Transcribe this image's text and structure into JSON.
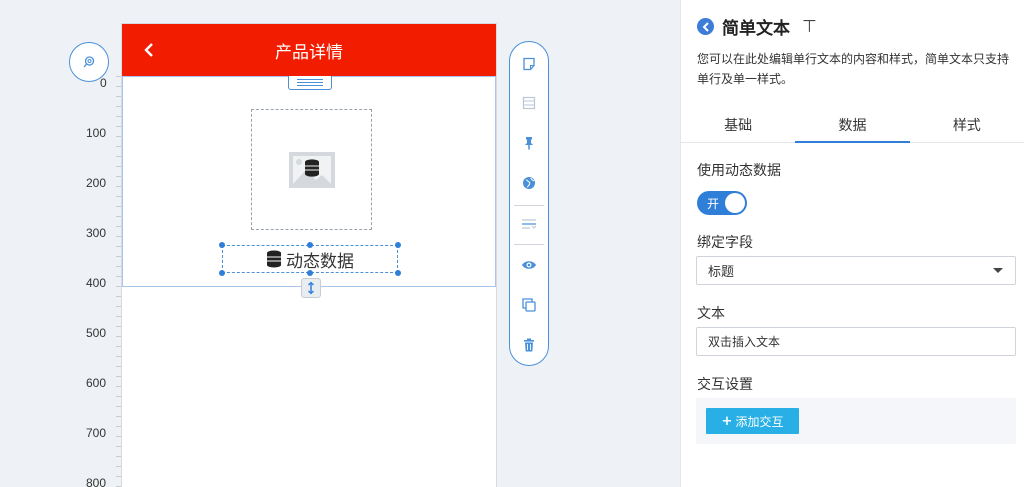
{
  "canvas": {
    "ruler_labels": [
      "0",
      "100",
      "200",
      "300",
      "400",
      "500",
      "600",
      "700",
      "800"
    ],
    "phone": {
      "title": "产品详情",
      "text_component": "动态数据"
    },
    "toolbar": {
      "tools": [
        "note-icon",
        "layout-icon",
        "pin-icon",
        "globe-icon",
        "text-align-icon",
        "eye-icon",
        "copy-icon",
        "trash-icon"
      ]
    }
  },
  "panel": {
    "title": "简单文本",
    "description": "您可以在此处编辑单行文本的内容和样式，简单文本只支持单行及单一样式。",
    "tabs": [
      "基础",
      "数据",
      "样式"
    ],
    "active_tab": "数据",
    "dynamic_label": "使用动态数据",
    "toggle_label": "开",
    "bind_label": "绑定字段",
    "bind_value": "标题",
    "text_label": "文本",
    "text_value": "双击插入文本",
    "interact_label": "交互设置",
    "add_interact": "添加交互"
  },
  "colors": {
    "header_red": "#f21d00",
    "accent_blue": "#2f7fd8",
    "add_button": "#28b0e6"
  }
}
